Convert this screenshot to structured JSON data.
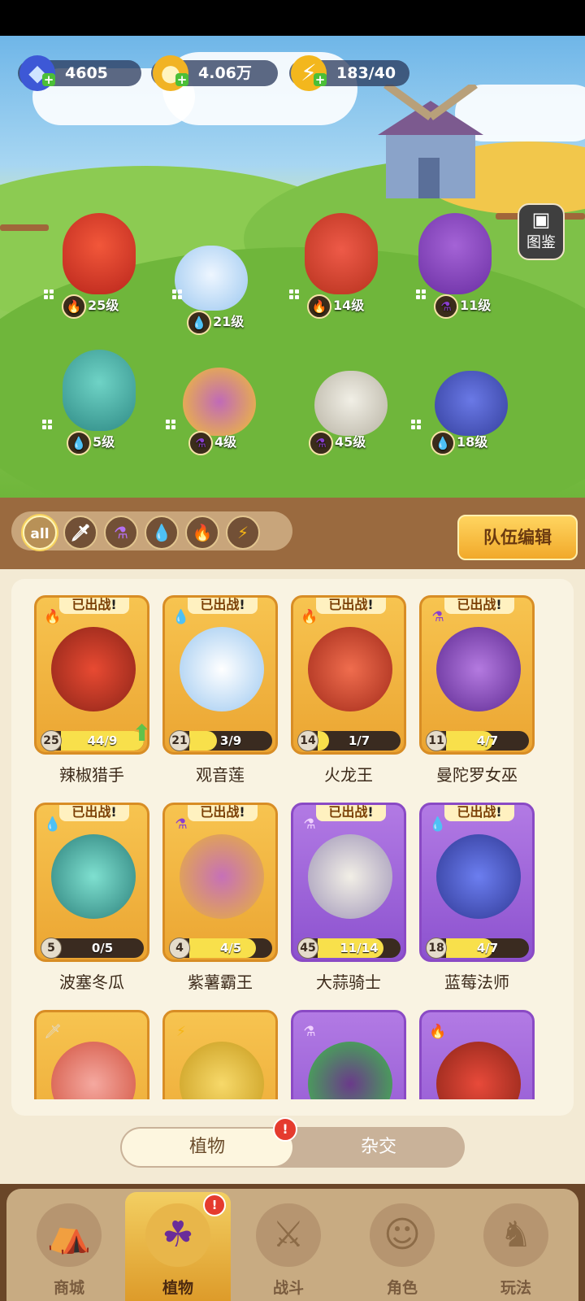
{
  "resources": {
    "gems": "4605",
    "gold": "4.06万",
    "energy": "183/40"
  },
  "encyclopedia_label": "图鉴",
  "field_plants": [
    {
      "level": "25级",
      "element": "fire"
    },
    {
      "level": "21级",
      "element": "water"
    },
    {
      "level": "14级",
      "element": "fire"
    },
    {
      "level": "11级",
      "element": "poison"
    },
    {
      "level": "5级",
      "element": "water"
    },
    {
      "level": "4级",
      "element": "poison"
    },
    {
      "level": "45级",
      "element": "poison"
    },
    {
      "level": "18级",
      "element": "water"
    }
  ],
  "filters": {
    "all_label": "all",
    "selected": "all",
    "options": [
      "all",
      "sword",
      "poison",
      "water",
      "fire",
      "lightning"
    ]
  },
  "team_edit_label": "队伍编辑",
  "deployed_tag": "已出战",
  "cards": [
    {
      "name": "辣椒猎手",
      "level": "25",
      "progress": "44/9",
      "fill": 1.0,
      "element": "fire",
      "rarity": "gold",
      "deployed": true,
      "upgradable": true
    },
    {
      "name": "观音莲",
      "level": "21",
      "progress": "3/9",
      "fill": 0.33,
      "element": "water",
      "rarity": "gold",
      "deployed": true
    },
    {
      "name": "火龙王",
      "level": "14",
      "progress": "1/7",
      "fill": 0.14,
      "element": "fire",
      "rarity": "gold",
      "deployed": true
    },
    {
      "name": "曼陀罗女巫",
      "level": "11",
      "progress": "4/7",
      "fill": 0.57,
      "element": "poison",
      "rarity": "gold",
      "deployed": true
    },
    {
      "name": "波塞冬瓜",
      "level": "5",
      "progress": "0/5",
      "fill": 0.0,
      "element": "water",
      "rarity": "gold",
      "deployed": true
    },
    {
      "name": "紫薯霸王",
      "level": "4",
      "progress": "4/5",
      "fill": 0.8,
      "element": "poison",
      "rarity": "gold",
      "deployed": true
    },
    {
      "name": "大蒜骑士",
      "level": "45",
      "progress": "11/14",
      "fill": 0.79,
      "element": "poison",
      "rarity": "purple",
      "deployed": true
    },
    {
      "name": "蓝莓法师",
      "level": "18",
      "progress": "4/7",
      "fill": 0.57,
      "element": "water",
      "rarity": "purple",
      "deployed": true
    },
    {
      "element": "sword",
      "rarity": "gold"
    },
    {
      "element": "lightning",
      "rarity": "gold"
    },
    {
      "element": "poison",
      "rarity": "purple"
    },
    {
      "element": "fire",
      "rarity": "purple"
    }
  ],
  "tabs": {
    "plants": "植物",
    "hybrid": "杂交",
    "badge": "!"
  },
  "nav": [
    {
      "label": "商城",
      "icon": "shop-icon"
    },
    {
      "label": "植物",
      "icon": "plants-icon",
      "active": true,
      "badge": "!"
    },
    {
      "label": "战斗",
      "icon": "battle-icon"
    },
    {
      "label": "角色",
      "icon": "character-icon"
    },
    {
      "label": "玩法",
      "icon": "gameplay-icon"
    }
  ],
  "colors": {
    "gold_card": "#eba532",
    "purple_card": "#8c52cf",
    "fire": "#f26a1b",
    "water": "#2f8fe0",
    "poison": "#8a3fd0",
    "lightning": "#f5b515"
  }
}
